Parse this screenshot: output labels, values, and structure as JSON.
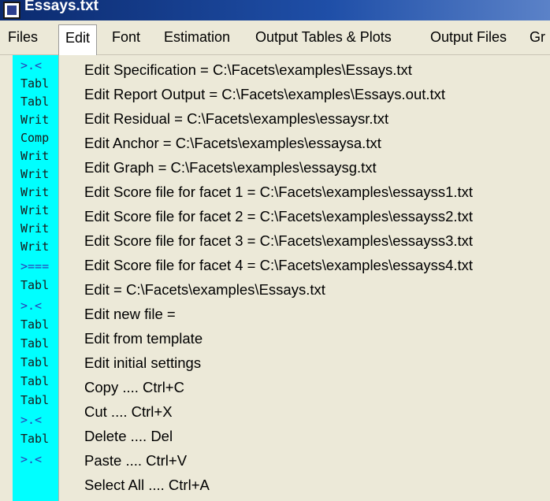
{
  "window": {
    "title": "Essays.txt"
  },
  "menubar": {
    "items": [
      {
        "label": "Files"
      },
      {
        "label": "Edit"
      },
      {
        "label": "Font"
      },
      {
        "label": "Estimation"
      },
      {
        "label": "Output Tables & Plots"
      },
      {
        "label": "Output Files"
      },
      {
        "label": "Gr"
      }
    ]
  },
  "console": {
    "lines": [
      ">.<",
      "Tabl",
      "Tabl",
      "Writ",
      "Comp",
      "Writ",
      "Writ",
      "Writ",
      "Writ",
      "Writ",
      "Writ",
      ">===",
      "Tabl",
      ">.<",
      "Tabl",
      "Tabl",
      "Tabl",
      "Tabl",
      "Tabl",
      ">.<",
      "Tabl",
      ">.<"
    ]
  },
  "edit_menu": {
    "items": [
      {
        "label": "Edit Specification = C:\\Facets\\examples\\Essays.txt"
      },
      {
        "label": "Edit Report Output = C:\\Facets\\examples\\Essays.out.txt"
      },
      {
        "label": "Edit Residual = C:\\Facets\\examples\\essaysr.txt"
      },
      {
        "label": "Edit Anchor = C:\\Facets\\examples\\essaysa.txt"
      },
      {
        "label": "Edit Graph = C:\\Facets\\examples\\essaysg.txt"
      },
      {
        "label": "Edit Score file for facet 1 = C:\\Facets\\examples\\essayss1.txt"
      },
      {
        "label": "Edit Score file for facet 2 = C:\\Facets\\examples\\essayss2.txt"
      },
      {
        "label": "Edit Score file for facet 3 = C:\\Facets\\examples\\essayss3.txt"
      },
      {
        "label": "Edit Score file for facet 4 = C:\\Facets\\examples\\essayss4.txt"
      },
      {
        "label": "Edit = C:\\Facets\\examples\\Essays.txt"
      },
      {
        "label": "Edit new file ="
      },
      {
        "label": "Edit from template"
      },
      {
        "label": "Edit initial settings"
      },
      {
        "label": "Copy .... Ctrl+C"
      },
      {
        "label": "Cut .... Ctrl+X"
      },
      {
        "label": "Delete .... Del"
      },
      {
        "label": "Paste .... Ctrl+V"
      },
      {
        "label": "Select All .... Ctrl+A"
      }
    ]
  }
}
